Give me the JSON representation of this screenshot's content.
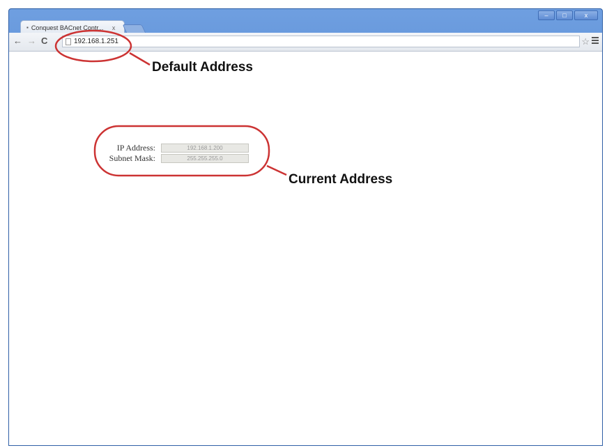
{
  "browser": {
    "tab_title": "Conquest BACnet Contr...",
    "tab_favicon": "page-icon",
    "tab_close": "x",
    "url": "192.168.1.251"
  },
  "window_controls": {
    "minimize": "–",
    "maximize": "□",
    "close": "x"
  },
  "form": {
    "ip_label": "IP Address:",
    "ip_value": "192.168.1.200",
    "mask_label": "Subnet Mask:",
    "mask_value": "255.255.255.0"
  },
  "annotations": {
    "default_address": "Default Address",
    "current_address": "Current Address",
    "circle_color": "#cc3333"
  }
}
